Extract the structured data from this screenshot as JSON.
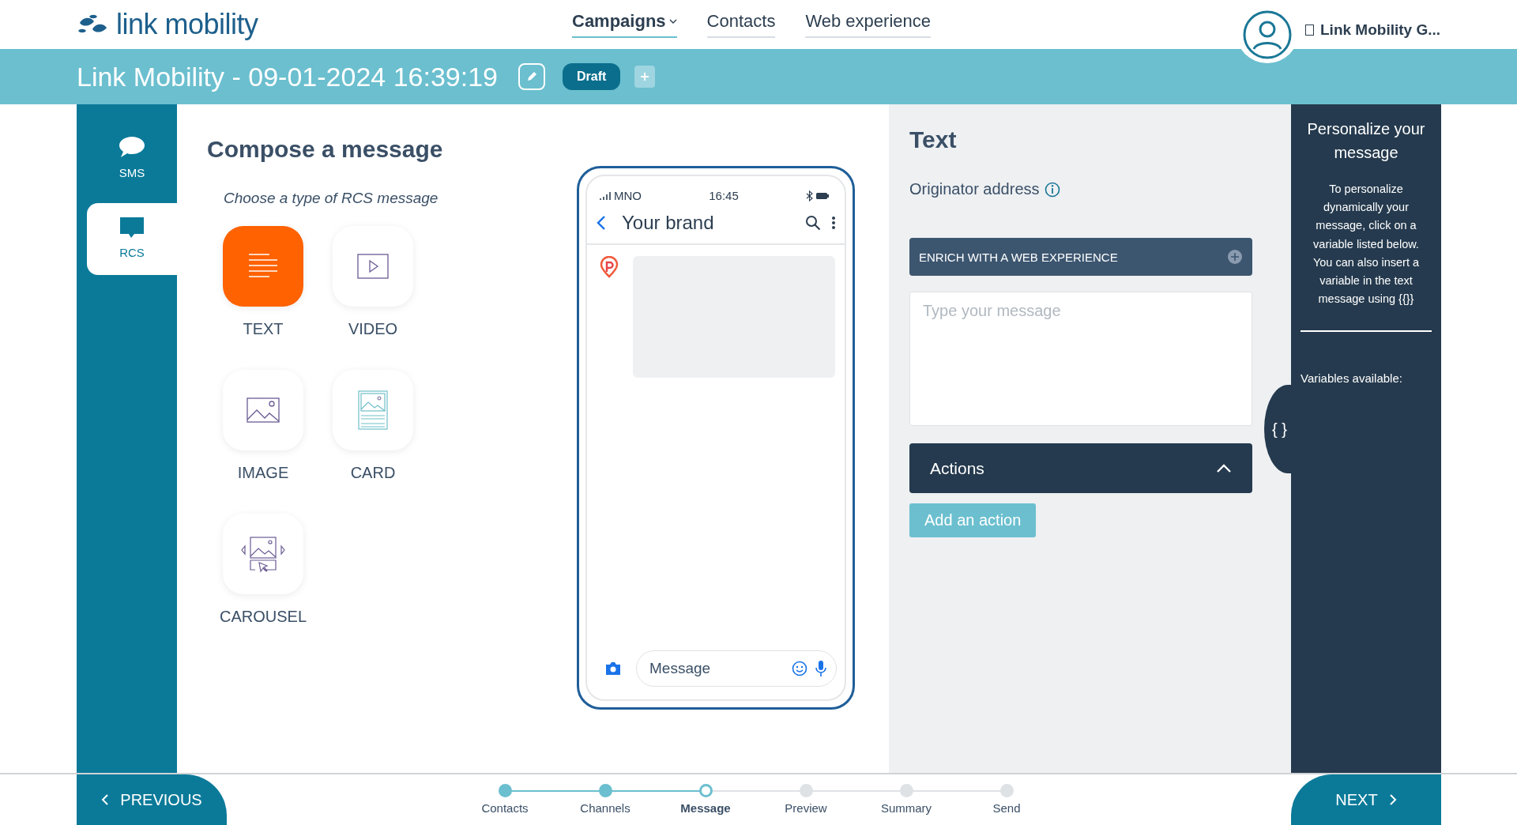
{
  "header": {
    "logo": "**link** mobility",
    "nav": [
      {
        "label": "Campaigns",
        "selected": true,
        "dropdown": true
      },
      {
        "label": "Contacts",
        "selected": false,
        "dropdown": false
      },
      {
        "label": "Web experience",
        "selected": false,
        "dropdown": false
      }
    ],
    "account": "Link Mobility G..."
  },
  "campaign": {
    "title": "Link Mobility - 09-01-2024 16:39:19",
    "status": "Draft"
  },
  "channels": [
    {
      "label": "SMS",
      "selected": false
    },
    {
      "label": "RCS",
      "selected": true
    }
  ],
  "compose": {
    "title": "Compose a message",
    "subtitle": "Choose a type of RCS message",
    "types": [
      {
        "label": "TEXT",
        "kind": "text",
        "selected": true
      },
      {
        "label": "VIDEO",
        "kind": "video",
        "selected": false
      },
      {
        "label": "IMAGE",
        "kind": "image",
        "selected": false
      },
      {
        "label": "CARD",
        "kind": "card",
        "selected": false
      },
      {
        "label": "CAROUSEL",
        "kind": "carousel",
        "selected": false
      }
    ]
  },
  "preview": {
    "carrier": "MNO",
    "time": "16:45",
    "brand": "Your brand",
    "input_placeholder": "Message"
  },
  "editor": {
    "title": "Text",
    "originator_label": "Originator address",
    "enrich_label": "ENRICH WITH A WEB EXPERIENCE",
    "message_placeholder": "Type your message",
    "actions": {
      "title": "Actions",
      "expanded": true
    },
    "add_action": "Add an action"
  },
  "personalize": {
    "title": "Personalize your message",
    "description": "To personalize dynamically your message, click on a variable listed below. You can also insert a variable in the text message using {{}}",
    "variables_label": "Variables available:",
    "tab_label": "{ }"
  },
  "footer": {
    "previous": "PREVIOUS",
    "next": "NEXT",
    "steps": [
      {
        "label": "Contacts",
        "done": true,
        "selected": false
      },
      {
        "label": "Channels",
        "done": true,
        "selected": false
      },
      {
        "label": "Message",
        "done": false,
        "selected": true
      },
      {
        "label": "Preview",
        "done": false,
        "selected": false
      },
      {
        "label": "Summary",
        "done": false,
        "selected": false
      },
      {
        "label": "Send",
        "done": false,
        "selected": false
      }
    ]
  }
}
